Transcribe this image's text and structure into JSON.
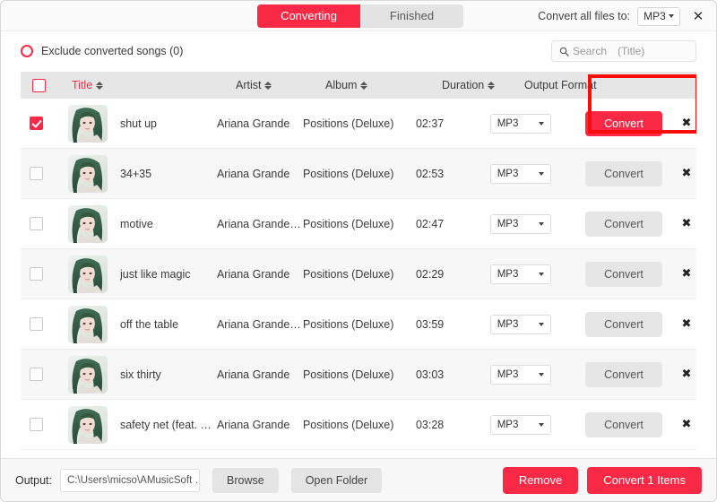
{
  "window": {
    "close_label": "✕"
  },
  "topbar": {
    "tabs": [
      {
        "label": "Converting",
        "active": true
      },
      {
        "label": "Finished",
        "active": false
      }
    ],
    "convert_all_label": "Convert all files to:",
    "convert_all_format": "MP3"
  },
  "filterbar": {
    "exclude_label": "Exclude converted songs (0)",
    "search_placeholder": "Search (Title)"
  },
  "table": {
    "headers": {
      "title": "Title",
      "artist": "Artist",
      "album": "Album",
      "duration": "Duration",
      "output_format": "Output Format"
    },
    "rows": [
      {
        "checked": true,
        "title": "shut up",
        "artist": "Ariana Grande",
        "album": "Positions (Deluxe)",
        "duration": "02:37",
        "format": "MP3",
        "convert_label": "Convert",
        "convert_primary": true,
        "remove_label": "✖"
      },
      {
        "checked": false,
        "title": "34+35",
        "artist": "Ariana Grande",
        "album": "Positions (Deluxe)",
        "duration": "02:53",
        "format": "MP3",
        "convert_label": "Convert",
        "convert_primary": false,
        "remove_label": "✖"
      },
      {
        "checked": false,
        "title": "motive",
        "artist": "Ariana Grande & …",
        "album": "Positions (Deluxe)",
        "duration": "02:47",
        "format": "MP3",
        "convert_label": "Convert",
        "convert_primary": false,
        "remove_label": "✖"
      },
      {
        "checked": false,
        "title": "just like magic",
        "artist": "Ariana Grande",
        "album": "Positions (Deluxe)",
        "duration": "02:29",
        "format": "MP3",
        "convert_label": "Convert",
        "convert_primary": false,
        "remove_label": "✖"
      },
      {
        "checked": false,
        "title": "off the table",
        "artist": "Ariana Grande & …",
        "album": "Positions (Deluxe)",
        "duration": "03:59",
        "format": "MP3",
        "convert_label": "Convert",
        "convert_primary": false,
        "remove_label": "✖"
      },
      {
        "checked": false,
        "title": "six thirty",
        "artist": "Ariana Grande",
        "album": "Positions (Deluxe)",
        "duration": "03:03",
        "format": "MP3",
        "convert_label": "Convert",
        "convert_primary": false,
        "remove_label": "✖"
      },
      {
        "checked": false,
        "title": "safety net (feat. Ty …",
        "artist": "Ariana Grande",
        "album": "Positions (Deluxe)",
        "duration": "03:28",
        "format": "MP3",
        "convert_label": "Convert",
        "convert_primary": false,
        "remove_label": "✖"
      }
    ]
  },
  "bottombar": {
    "output_label": "Output:",
    "output_path": "C:\\Users\\micso\\AMusicSoft …",
    "browse_label": "Browse",
    "open_folder_label": "Open Folder",
    "remove_label": "Remove",
    "convert_items_label": "Convert 1 Items"
  },
  "colors": {
    "accent": "#fa2a46",
    "highlight": "#fb0d07",
    "header_bg": "#e6e6e6"
  }
}
